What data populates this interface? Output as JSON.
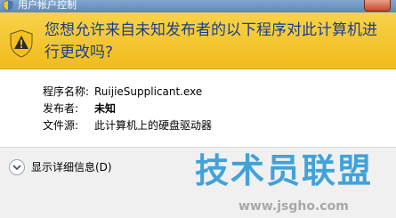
{
  "window": {
    "title": "用户帐户控制"
  },
  "banner": {
    "message": "您想允许来自未知发布者的以下程序对此计算机进行更改吗?"
  },
  "details": {
    "program_label": "程序名称:",
    "program_value": "RuijieSupplicant.exe",
    "publisher_label": "发布者:",
    "publisher_value": "未知",
    "source_label": "文件源:",
    "source_value": "此计算机上的硬盘驱动器"
  },
  "footer": {
    "show_details_label": "显示详细信息(D)"
  },
  "watermark": {
    "brand": "技术员联盟",
    "url": "www.jsgho.com"
  },
  "icons": {
    "title": "uac-shield-icon",
    "banner": "warning-shield-icon",
    "expander": "chevron-down-icon"
  },
  "colors": {
    "banner": "#f1bb1d",
    "banner_text": "#1a3e8c",
    "titlebar": "#6a93be",
    "watermark": "#2f9ad8"
  }
}
